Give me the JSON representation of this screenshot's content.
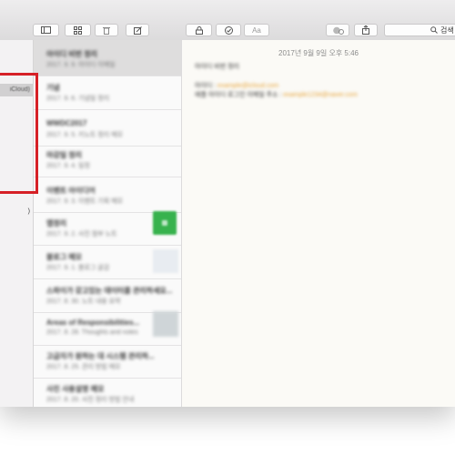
{
  "toolbar": {
    "search_placeholder": "검색",
    "font_button_label": "Aa"
  },
  "sidebar": {
    "items": [
      {
        "label": "iCloud)"
      },
      {
        "label": ")"
      }
    ]
  },
  "note_list": {
    "notes": [
      {
        "title": "아이디 비번 정리",
        "snippet": "2017. 9. 9. 아이디 이메일"
      },
      {
        "title": "기념",
        "snippet": "2017. 9. 6. 기념일 정리"
      },
      {
        "title": "WWDC2017",
        "snippet": "2017. 9. 5. 키노트 정리 메모"
      },
      {
        "title": "마감일 정리",
        "snippet": "2017. 9. 4. 일정"
      },
      {
        "title": "이벤트 아이디어",
        "snippet": "2017. 9. 3. 이벤트 기획 메모"
      },
      {
        "title": "앱정리",
        "snippet": "2017. 9. 2. 사진 첨부 노트"
      },
      {
        "title": "블로그 메모",
        "snippet": "2017. 9. 1. 블로그 글감"
      },
      {
        "title": "스파이가 갖고있는 데이터를 관리하세요...",
        "snippet": "2017. 8. 30. 노트 내용 요약"
      },
      {
        "title": "Areas of Responsibilities...",
        "snippet": "2017. 8. 28. Thoughts and notes"
      },
      {
        "title": "고급자가 원하는 대 시스템 관리하...",
        "snippet": "2017. 8. 25. 관리 방법 메모"
      },
      {
        "title": "사진 사용설명 메모",
        "snippet": "2017. 8. 20. 사진 정리 방법 안내"
      }
    ]
  },
  "editor": {
    "date": "2017년 9월 9일 오후 5:46",
    "heading": "아이디 비번 정리",
    "line1_label": "아이디 :",
    "line1_link": "example@icloud.com",
    "line2_label": "애플 아이디 로그인 이메일 주소 :",
    "line2_link": "example1234@naver.com"
  },
  "colors": {
    "annotation": "#d62026",
    "link": "#e7a53b",
    "thumbnail_green": "#37b24d"
  },
  "icons": [
    "sidebar-toggle-icon",
    "gallery-icon",
    "trash-icon",
    "compose-icon",
    "lock-icon",
    "checklist-icon",
    "font-icon",
    "add-people-icon",
    "share-icon",
    "search-icon"
  ]
}
